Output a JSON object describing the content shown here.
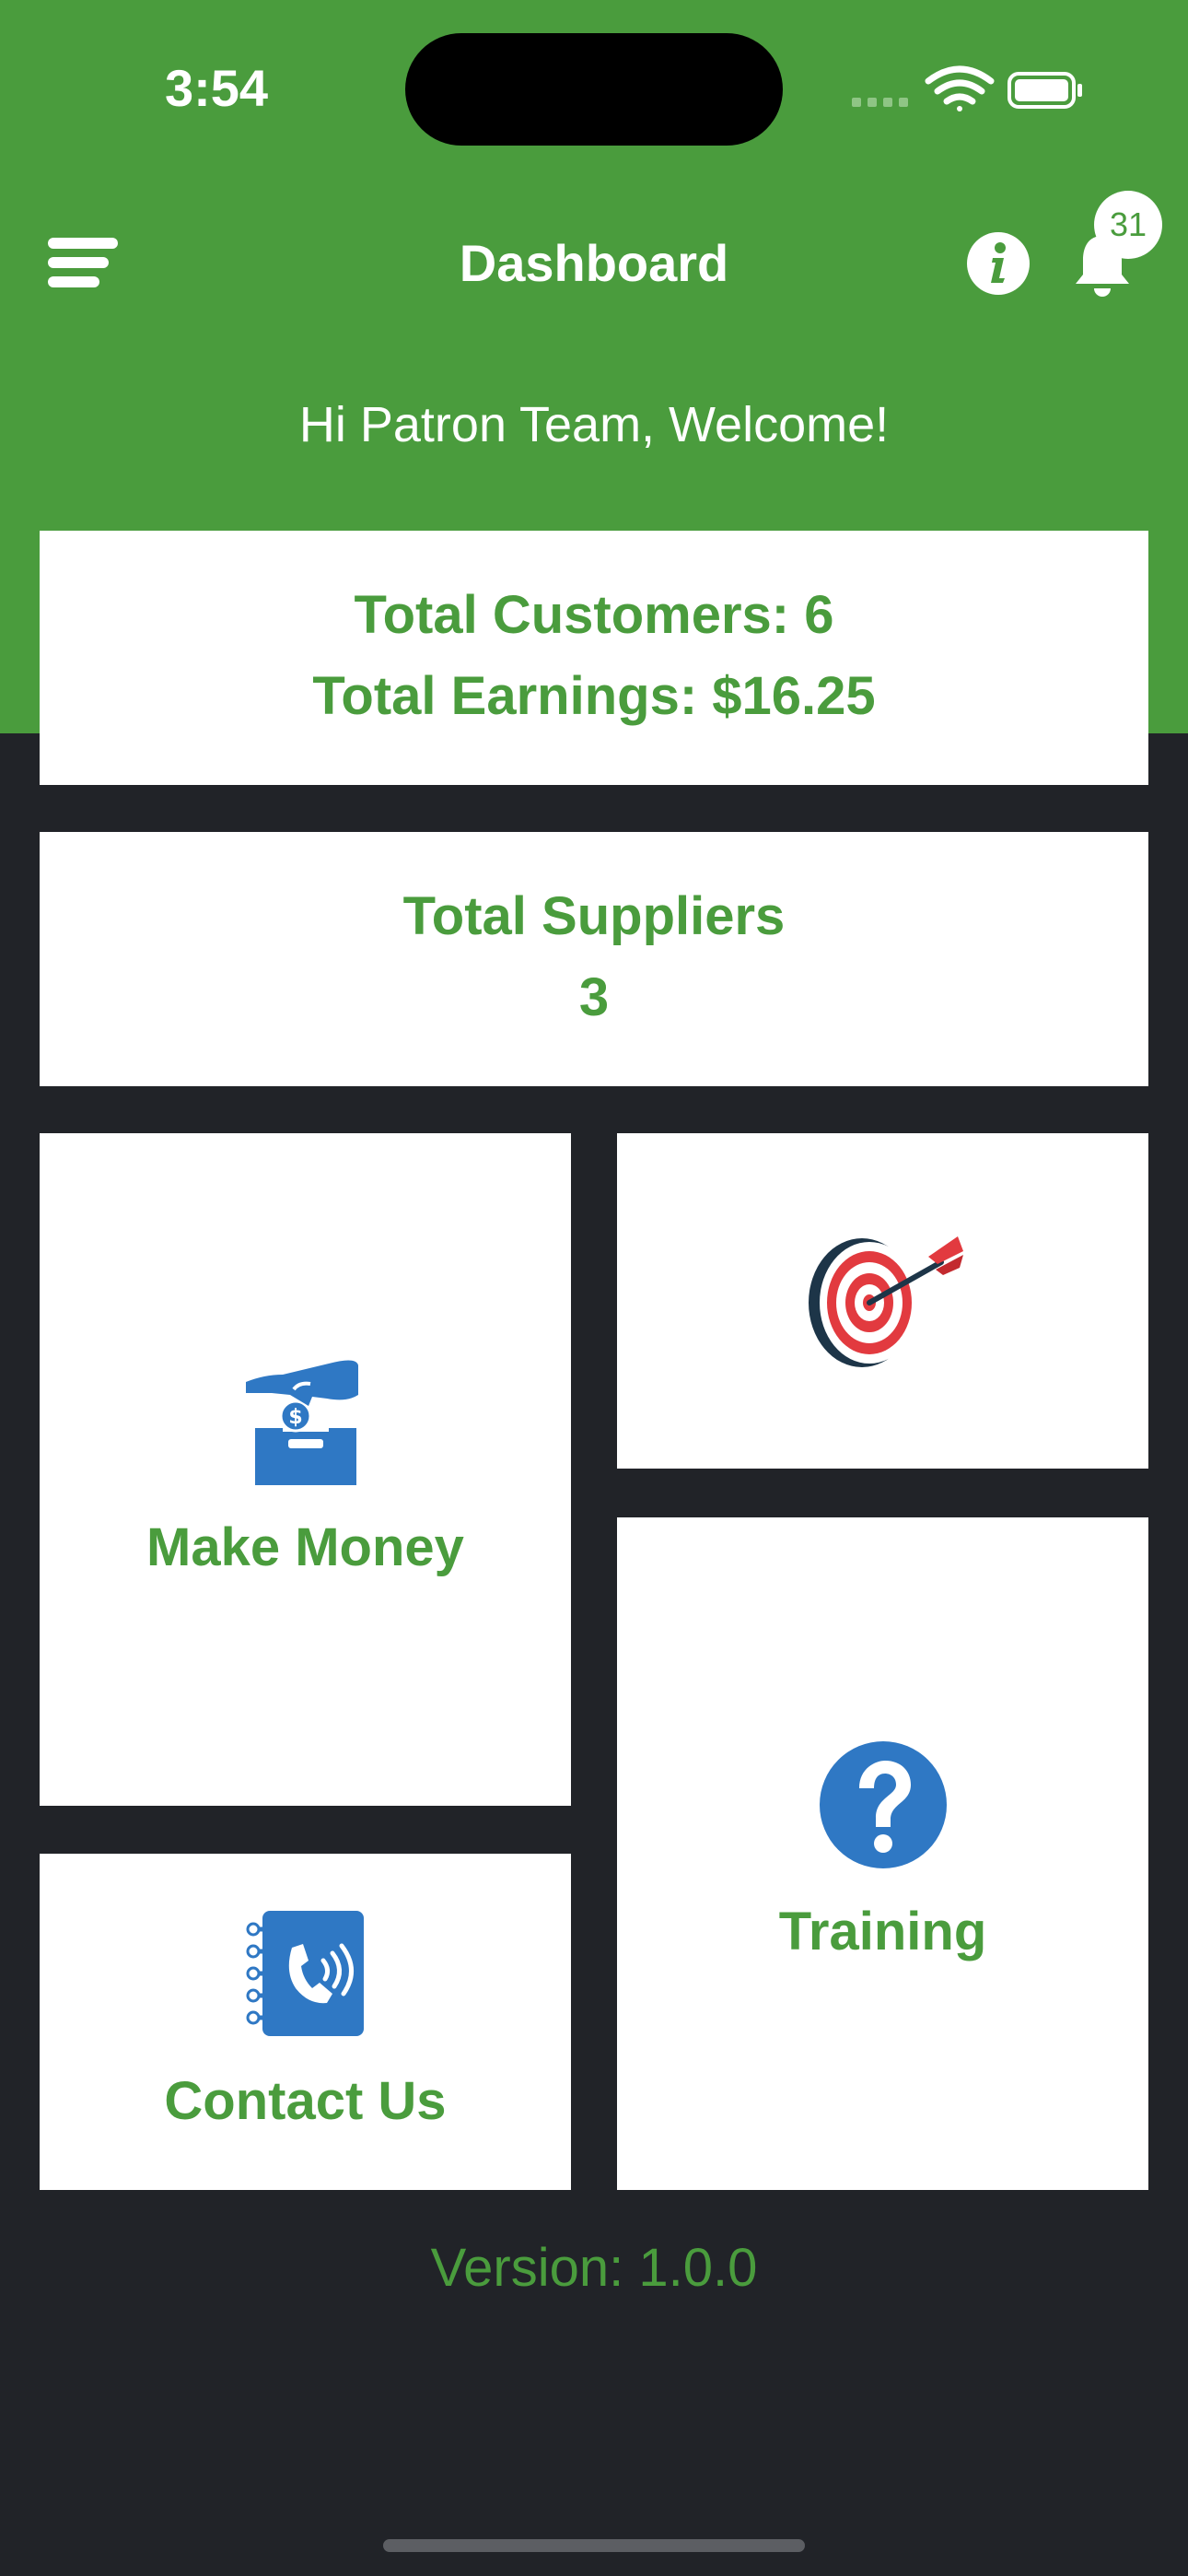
{
  "status_bar": {
    "time": "3:54",
    "icons": [
      "signal-icon",
      "wifi-icon",
      "battery-icon"
    ]
  },
  "header": {
    "title": "Dashboard",
    "notification_count": "31",
    "menu_icon": "menu-icon",
    "info_icon": "info-icon",
    "bell_icon": "bell-icon"
  },
  "welcome": "Hi Patron Team, Welcome!",
  "stats": {
    "customers": "Total Customers: 6",
    "earnings": "Total Earnings: $16.25",
    "suppliers_label": "Total Suppliers",
    "suppliers_value": "3"
  },
  "tiles": {
    "make_money": "Make Money",
    "target_icon": "target-icon",
    "training": "Training",
    "contact_us": "Contact Us"
  },
  "version": "Version: 1.0.0",
  "colors": {
    "brand_green": "#4a9c3d",
    "background": "#212328",
    "icon_blue": "#2f78c4"
  }
}
